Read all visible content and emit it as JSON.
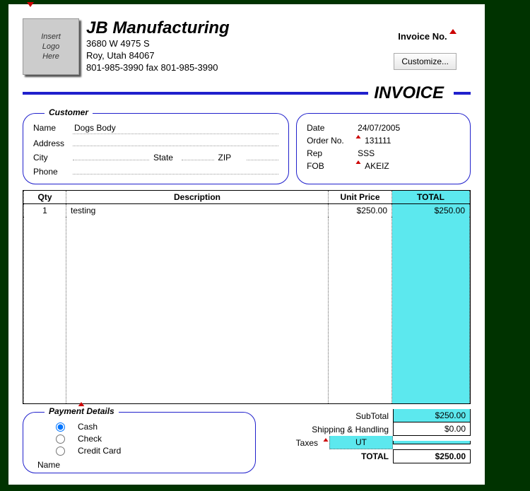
{
  "logo_placeholder": "Insert\nLogo\nHere",
  "company": {
    "name": "JB Manufacturing",
    "street": "3680 W 4975 S",
    "city_line": "Roy, Utah 84067",
    "phone_line": "801-985-3990 fax 801-985-3990"
  },
  "invoice_no_label": "Invoice No.",
  "customize_label": "Customize...",
  "doc_title": "INVOICE",
  "customer_legend": "Customer",
  "customer_fields": {
    "name_label": "Name",
    "name": "Dogs Body",
    "address_label": "Address",
    "address": "",
    "city_label": "City",
    "city": "",
    "state_label": "State",
    "state": "",
    "zip_label": "ZIP",
    "zip": "",
    "phone_label": "Phone",
    "phone": ""
  },
  "meta": {
    "date_label": "Date",
    "date": "24/07/2005",
    "order_label": "Order No.",
    "order": "131111",
    "rep_label": "Rep",
    "rep": "SSS",
    "fob_label": "FOB",
    "fob": "AKEIZ"
  },
  "headers": {
    "qty": "Qty",
    "desc": "Description",
    "price": "Unit Price",
    "total": "TOTAL"
  },
  "line": {
    "qty": "1",
    "desc": "testing",
    "price": "$250.00",
    "total": "$250.00"
  },
  "totals": {
    "subtotal_label": "SubTotal",
    "subtotal": "$250.00",
    "ship_label": "Shipping & Handling",
    "ship": "$0.00",
    "taxes_label": "Taxes",
    "tax_code": "UT",
    "taxes": "",
    "grand_label": "TOTAL",
    "grand": "$250.00"
  },
  "payment": {
    "legend": "Payment Details",
    "cash": "Cash",
    "check": "Check",
    "cc": "Credit Card",
    "name_label": "Name"
  }
}
